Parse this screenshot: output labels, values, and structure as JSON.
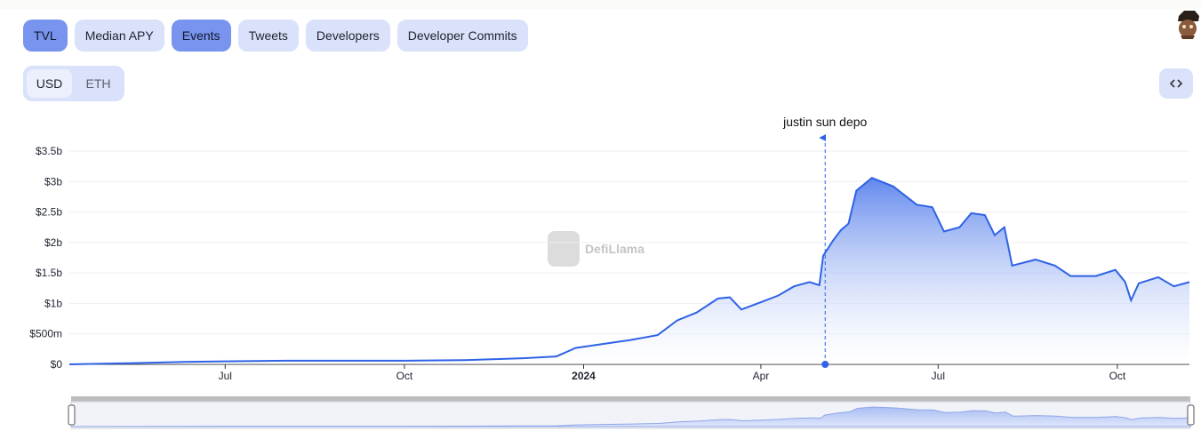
{
  "tabs": [
    {
      "label": "TVL",
      "active": true
    },
    {
      "label": "Median APY",
      "active": false
    },
    {
      "label": "Events",
      "active": true
    },
    {
      "label": "Tweets",
      "active": false
    },
    {
      "label": "Developers",
      "active": false
    },
    {
      "label": "Developer Commits",
      "active": false
    }
  ],
  "currency": {
    "options": [
      "USD",
      "ETH"
    ],
    "selected": "USD"
  },
  "embed_icon": "code-brackets-icon",
  "watermark": "DefiLlama",
  "colors": {
    "accent": "#2f62e6",
    "active_tab": "#7894ee",
    "tab": "#d9e2fa"
  },
  "chart_data": {
    "type": "area",
    "title": "",
    "xlabel": "",
    "ylabel": "",
    "x_range": [
      "2023-04-12",
      "2024-11-07"
    ],
    "ylim": [
      0,
      3.5
    ],
    "y_unit": "$b",
    "y_ticks": [
      "$0",
      "$500m",
      "$1b",
      "$1.5b",
      "$2b",
      "$2.5b",
      "$3b",
      "$3.5b"
    ],
    "x_ticks": [
      {
        "label": "Jul",
        "date": "2023-07-01",
        "bold": false
      },
      {
        "label": "Oct",
        "date": "2023-10-01",
        "bold": false
      },
      {
        "label": "2024",
        "date": "2024-01-01",
        "bold": true
      },
      {
        "label": "Apr",
        "date": "2024-04-01",
        "bold": false
      },
      {
        "label": "Jul",
        "date": "2024-07-01",
        "bold": false
      },
      {
        "label": "Oct",
        "date": "2024-10-01",
        "bold": false
      }
    ],
    "series": [
      {
        "name": "TVL",
        "points": [
          [
            "2023-04-12",
            0.0
          ],
          [
            "2023-05-15",
            0.02
          ],
          [
            "2023-06-10",
            0.04
          ],
          [
            "2023-07-01",
            0.05
          ],
          [
            "2023-08-01",
            0.06
          ],
          [
            "2023-09-01",
            0.06
          ],
          [
            "2023-10-01",
            0.06
          ],
          [
            "2023-11-01",
            0.07
          ],
          [
            "2023-12-01",
            0.1
          ],
          [
            "2023-12-18",
            0.13
          ],
          [
            "2023-12-28",
            0.27
          ],
          [
            "2024-01-10",
            0.33
          ],
          [
            "2024-01-25",
            0.4
          ],
          [
            "2024-02-08",
            0.48
          ],
          [
            "2024-02-18",
            0.72
          ],
          [
            "2024-02-28",
            0.85
          ],
          [
            "2024-03-10",
            1.08
          ],
          [
            "2024-03-16",
            1.1
          ],
          [
            "2024-03-22",
            0.9
          ],
          [
            "2024-04-01",
            1.02
          ],
          [
            "2024-04-10",
            1.13
          ],
          [
            "2024-04-18",
            1.28
          ],
          [
            "2024-04-26",
            1.35
          ],
          [
            "2024-05-01",
            1.3
          ],
          [
            "2024-05-03",
            1.78
          ],
          [
            "2024-05-08",
            2.03
          ],
          [
            "2024-05-12",
            2.2
          ],
          [
            "2024-05-16",
            2.31
          ],
          [
            "2024-05-20",
            2.85
          ],
          [
            "2024-05-28",
            3.06
          ],
          [
            "2024-06-08",
            2.92
          ],
          [
            "2024-06-20",
            2.62
          ],
          [
            "2024-06-28",
            2.58
          ],
          [
            "2024-07-04",
            2.18
          ],
          [
            "2024-07-12",
            2.25
          ],
          [
            "2024-07-18",
            2.48
          ],
          [
            "2024-07-25",
            2.45
          ],
          [
            "2024-07-30",
            2.12
          ],
          [
            "2024-08-04",
            2.25
          ],
          [
            "2024-08-08",
            1.62
          ],
          [
            "2024-08-20",
            1.72
          ],
          [
            "2024-08-30",
            1.62
          ],
          [
            "2024-09-07",
            1.45
          ],
          [
            "2024-09-20",
            1.45
          ],
          [
            "2024-09-30",
            1.55
          ],
          [
            "2024-10-05",
            1.35
          ],
          [
            "2024-10-08",
            1.05
          ],
          [
            "2024-10-12",
            1.33
          ],
          [
            "2024-10-22",
            1.43
          ],
          [
            "2024-10-30",
            1.28
          ],
          [
            "2024-11-07",
            1.35
          ]
        ]
      }
    ],
    "annotations": [
      {
        "label": "justin sun depo",
        "date": "2024-05-04"
      }
    ],
    "grid": true,
    "legend": "none"
  }
}
